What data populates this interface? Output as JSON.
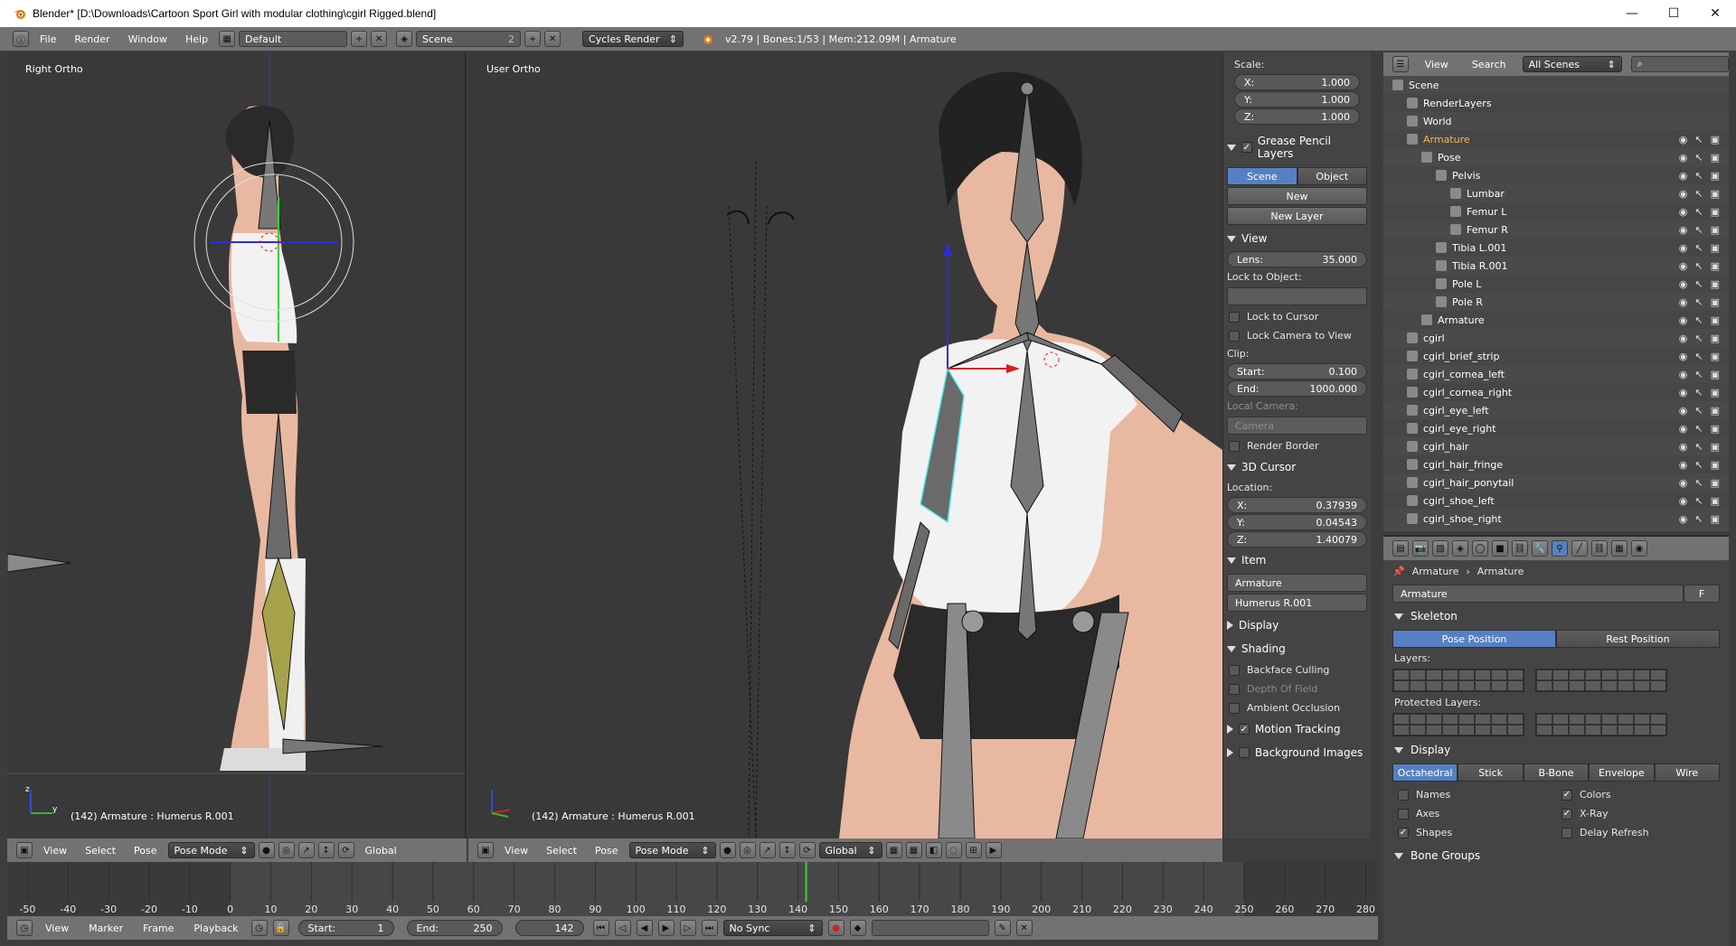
{
  "window": {
    "title": "Blender* [D:\\Downloads\\Cartoon Sport Girl with modular clothing\\cgirl Rigged.blend]",
    "minimize": "—",
    "maximize": "☐",
    "close": "✕"
  },
  "info_header": {
    "menus": [
      "File",
      "Render",
      "Window",
      "Help"
    ],
    "layout": "Default",
    "scene": "Scene",
    "scene_users": "2",
    "engine": "Cycles Render",
    "status": "v2.79 | Bones:1/53  | Mem:212.09M | Armature"
  },
  "viewport_left": {
    "label": "Right Ortho",
    "bottom_label": "(142) Armature : Humerus R.001",
    "header": {
      "menus": [
        "View",
        "Select",
        "Pose"
      ],
      "mode": "Pose Mode",
      "orientation": "Global"
    }
  },
  "viewport_right": {
    "label": "User Ortho",
    "bottom_label": "(142) Armature : Humerus R.001",
    "header": {
      "menus": [
        "View",
        "Select",
        "Pose"
      ],
      "mode": "Pose Mode",
      "orientation": "Global"
    }
  },
  "npanel": {
    "scale_label": "Scale:",
    "scale": {
      "x": "1.000",
      "y": "1.000",
      "z": "1.000"
    },
    "grease_pencil": {
      "title": "Grease Pencil Layers",
      "tab_scene": "Scene",
      "tab_object": "Object",
      "new": "New",
      "new_layer": "New Layer"
    },
    "view": {
      "title": "View",
      "lens_label": "Lens:",
      "lens": "35.000",
      "lock_to_object": "Lock to Object:",
      "lock_to_cursor": "Lock to Cursor",
      "lock_camera": "Lock Camera to View",
      "clip": "Clip:",
      "start_label": "Start:",
      "start": "0.100",
      "end_label": "End:",
      "end": "1000.000",
      "local_camera": "Local Camera:",
      "camera": "Camera",
      "render_border": "Render Border"
    },
    "cursor": {
      "title": "3D Cursor",
      "location": "Location:",
      "x": "0.37939",
      "y": "0.04543",
      "z": "1.40079"
    },
    "item": {
      "title": "Item",
      "object": "Armature",
      "bone": "Humerus R.001"
    },
    "display": {
      "title": "Display"
    },
    "shading": {
      "title": "Shading",
      "backface": "Backface Culling",
      "dof": "Depth Of Field",
      "ao": "Ambient Occlusion"
    },
    "motion_tracking": "Motion Tracking",
    "background_images": "Background Images"
  },
  "outliner": {
    "header": {
      "view": "View",
      "search": "Search",
      "filter": "All Scenes"
    },
    "rows": [
      {
        "label": "Scene",
        "indent": 0
      },
      {
        "label": "RenderLayers",
        "indent": 1
      },
      {
        "label": "World",
        "indent": 1
      },
      {
        "label": "Armature",
        "indent": 1,
        "color": "#f5b64a"
      },
      {
        "label": "Pose",
        "indent": 2
      },
      {
        "label": "Pelvis",
        "indent": 3
      },
      {
        "label": "Lumbar",
        "indent": 4
      },
      {
        "label": "Femur L",
        "indent": 4
      },
      {
        "label": "Femur R",
        "indent": 4
      },
      {
        "label": "Tibia L.001",
        "indent": 3
      },
      {
        "label": "Tibia R.001",
        "indent": 3
      },
      {
        "label": "Pole L",
        "indent": 3
      },
      {
        "label": "Pole R",
        "indent": 3
      },
      {
        "label": "Armature",
        "indent": 2
      },
      {
        "label": "cgirl",
        "indent": 1
      },
      {
        "label": "cgirl_brief_strip",
        "indent": 1
      },
      {
        "label": "cgirl_cornea_left",
        "indent": 1
      },
      {
        "label": "cgirl_cornea_right",
        "indent": 1
      },
      {
        "label": "cgirl_eye_left",
        "indent": 1
      },
      {
        "label": "cgirl_eye_right",
        "indent": 1
      },
      {
        "label": "cgirl_hair",
        "indent": 1
      },
      {
        "label": "cgirl_hair_fringe",
        "indent": 1
      },
      {
        "label": "cgirl_hair_ponytail",
        "indent": 1
      },
      {
        "label": "cgirl_shoe_left",
        "indent": 1
      },
      {
        "label": "cgirl_shoe_right",
        "indent": 1
      }
    ]
  },
  "properties": {
    "breadcrumb": [
      "Armature",
      "Armature"
    ],
    "datablock": "Armature",
    "datablock_flag": "F",
    "skeleton": {
      "title": "Skeleton",
      "pose_position": "Pose Position",
      "rest_position": "Rest Position",
      "layers": "Layers:",
      "protected_layers": "Protected Layers:"
    },
    "display": {
      "title": "Display",
      "types": [
        "Octahedral",
        "Stick",
        "B-Bone",
        "Envelope",
        "Wire"
      ],
      "names": "Names",
      "axes": "Axes",
      "shapes": "Shapes",
      "colors": "Colors",
      "xray": "X-Ray",
      "delay_refresh": "Delay Refresh"
    },
    "bone_groups": "Bone Groups"
  },
  "timeline": {
    "ticks": [
      "-50",
      "-40",
      "-30",
      "-20",
      "-10",
      "0",
      "10",
      "20",
      "30",
      "40",
      "50",
      "60",
      "70",
      "80",
      "90",
      "100",
      "110",
      "120",
      "130",
      "140",
      "150",
      "160",
      "170",
      "180",
      "190",
      "200",
      "210",
      "220",
      "230",
      "240",
      "250",
      "260",
      "270",
      "280"
    ],
    "current_frame_value": 142,
    "range_min": -55,
    "range_max": 283,
    "menus": [
      "View",
      "Marker",
      "Frame",
      "Playback"
    ],
    "start_label": "Start:",
    "start": "1",
    "end_label": "End:",
    "end": "250",
    "current": "142",
    "sync": "No Sync"
  }
}
